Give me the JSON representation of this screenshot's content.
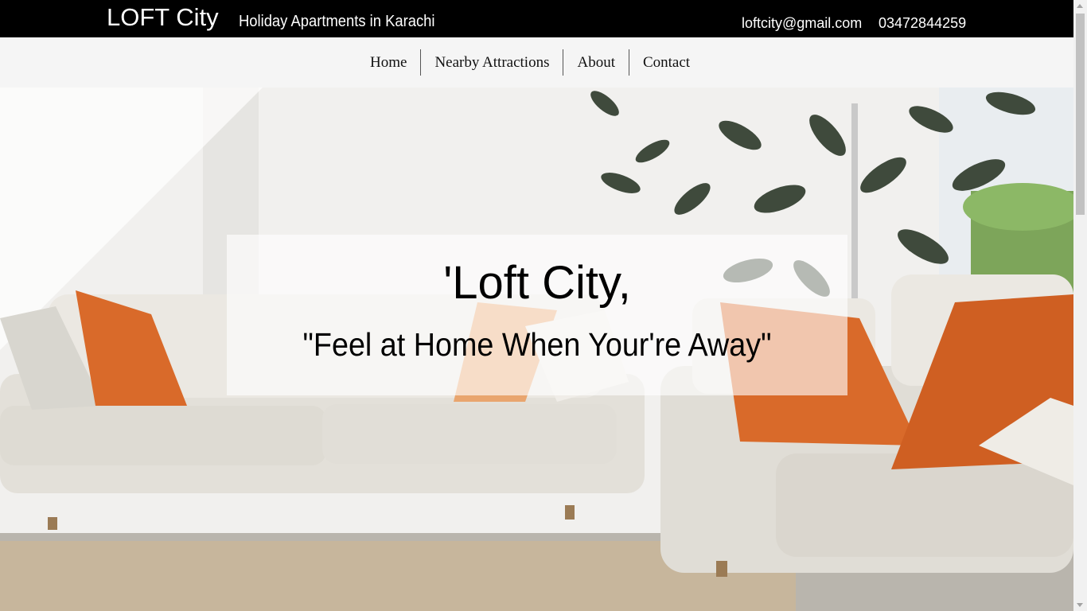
{
  "header": {
    "brand": "LOFT City",
    "tagline": "Holiday Apartments in Karachi",
    "email": "loftcity@gmail.com",
    "phone": "03472844259"
  },
  "nav": {
    "items": [
      "Home",
      "Nearby Attractions",
      "About",
      "Contact"
    ]
  },
  "hero": {
    "title": "'Loft City,",
    "subtitle": "\"Feel at Home When Your're Away\"",
    "image": "living-room-sofas-photo",
    "accent_colors": {
      "pillow": "#d96a2a",
      "sofa": "#e6e3dc",
      "plant": "#3f4a3c"
    }
  }
}
